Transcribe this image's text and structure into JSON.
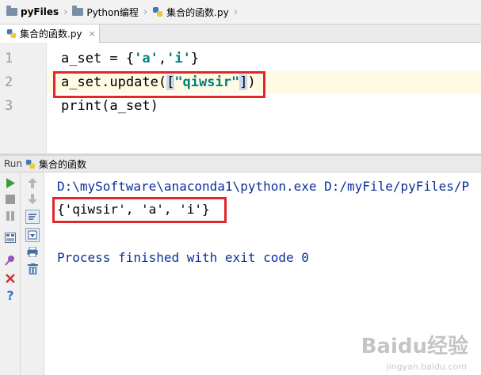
{
  "breadcrumb": {
    "items": [
      {
        "label": "pyFiles"
      },
      {
        "label": "Python编程"
      },
      {
        "label": "集合的函数.py"
      }
    ]
  },
  "tabs": [
    {
      "label": "集合的函数.py",
      "close": "×"
    }
  ],
  "editor": {
    "lines": [
      {
        "num": "1",
        "code": "a_set = {'a','i'}"
      },
      {
        "num": "2",
        "code": "a_set.update([\"qiwsir\"])"
      },
      {
        "num": "3",
        "code": "print(a_set)"
      }
    ],
    "line1": {
      "pre": "a_set = {",
      "s1": "'a'",
      "mid": ",",
      "s2": "'i'",
      "post": "}"
    },
    "line2": {
      "pre": "a_set.update(",
      "lb": "[",
      "s1": "\"qiwsir\"",
      "rb": "]",
      "post": ")"
    },
    "line3": {
      "code": "print(a_set)"
    }
  },
  "run": {
    "label": "Run",
    "config_name": "集合的函数"
  },
  "console": {
    "lines": [
      "D:\\mySoftware\\anaconda1\\python.exe D:/myFile/pyFiles/P",
      "{'qiwsir', 'a', 'i'}",
      "",
      "Process finished with exit code 0"
    ]
  },
  "watermark": {
    "text": "Baidu经验",
    "sub": "jingyan.baidu.com"
  },
  "colors": {
    "highlight_box": "#e0272b",
    "string": "#008080",
    "console_blue": "#0b2f99"
  }
}
